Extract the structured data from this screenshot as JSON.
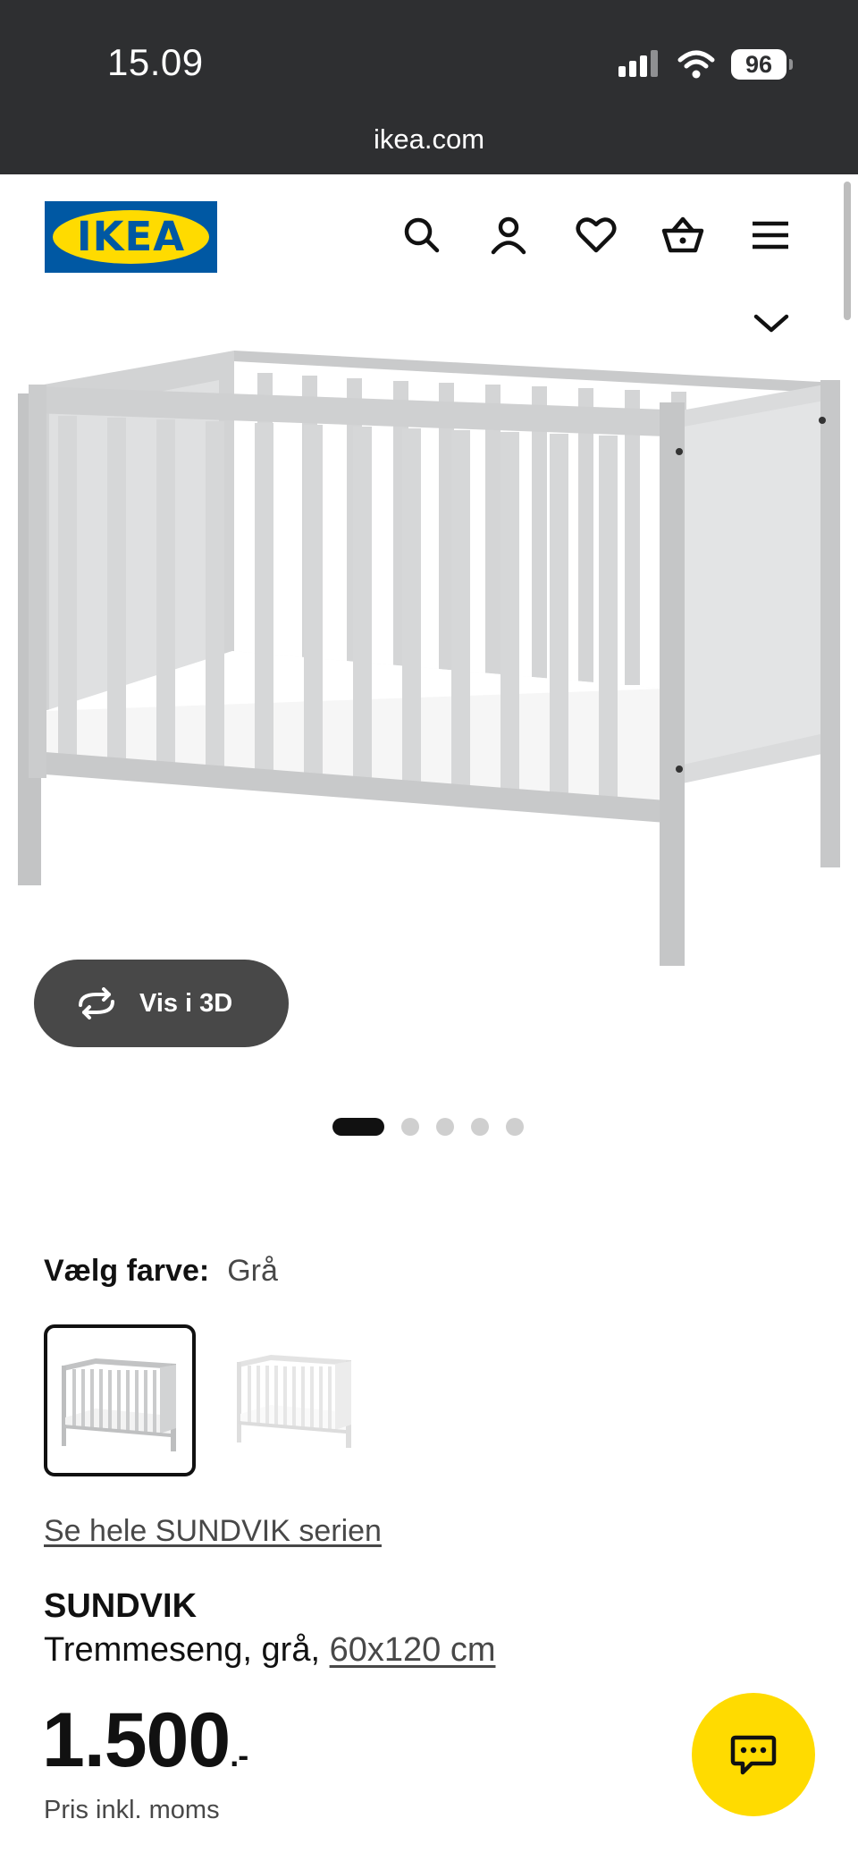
{
  "status_bar": {
    "time": "15.09",
    "battery": "96",
    "url": "ikea.com",
    "signal_icon": "cellular-signal-icon",
    "wifi_icon": "wifi-icon"
  },
  "header": {
    "logo_text": "IKEA",
    "icons": [
      "search-icon",
      "account-icon",
      "heart-icon",
      "basket-icon",
      "menu-icon"
    ]
  },
  "gallery": {
    "view_3d_label": "Vis i 3D",
    "slides": 5,
    "active_slide": 1
  },
  "color_picker": {
    "label": "Vælg farve:",
    "selected_value": "Grå",
    "options": [
      "gray",
      "white"
    ]
  },
  "product": {
    "series_link": "Se hele SUNDVIK serien",
    "name": "SUNDVIK",
    "description": "Tremmeseng, grå,",
    "size": "60x120 cm",
    "price": "1.500",
    "price_suffix": ".-",
    "price_note": "Pris inkl. moms"
  },
  "colors": {
    "status_bar_bg": "#2e2f31",
    "ikea_blue": "#0058a3",
    "ikea_yellow": "#ffdb00",
    "button_dark": "#484848"
  }
}
